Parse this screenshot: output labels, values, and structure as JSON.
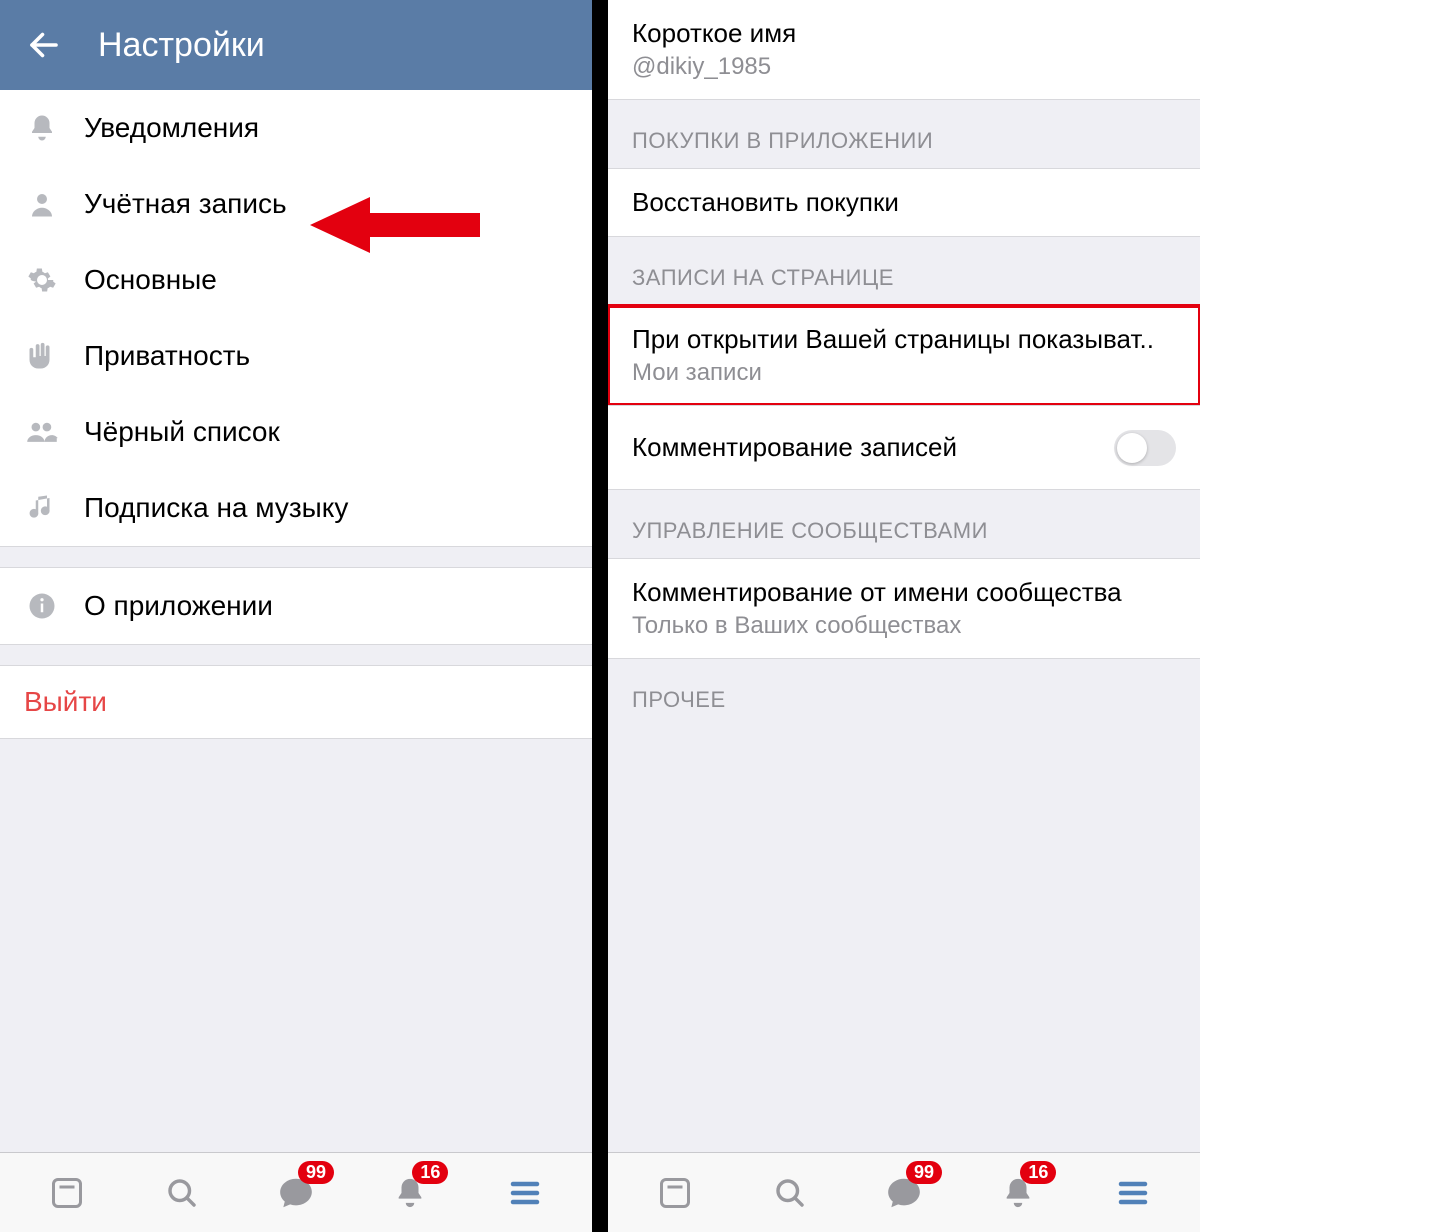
{
  "left": {
    "header_title": "Настройки",
    "items": {
      "notifications": "Уведомления",
      "account": "Учётная запись",
      "general": "Основные",
      "privacy": "Приватность",
      "blacklist": "Чёрный список",
      "music": "Подписка на музыку",
      "about": "О приложении",
      "logout": "Выйти"
    }
  },
  "right": {
    "short_name_label": "Короткое имя",
    "short_name_value": "@dikiy_1985",
    "section_purchases": "ПОКУПКИ В ПРИЛОЖЕНИИ",
    "restore_purchases": "Восстановить покупки",
    "section_wall": "ЗАПИСИ НА СТРАНИЦЕ",
    "wall_open_label": "При открытии Вашей страницы показыват..",
    "wall_open_value": "Мои записи",
    "comments_label": "Комментирование записей",
    "section_communities": "УПРАВЛЕНИЕ СООБЩЕСТВАМИ",
    "community_comment_label": "Комментирование от имени сообщества",
    "community_comment_value": "Только в Ваших сообществах",
    "section_other": "ПРОЧЕЕ"
  },
  "tabs": {
    "messages_badge": "99",
    "notifications_badge": "16"
  }
}
